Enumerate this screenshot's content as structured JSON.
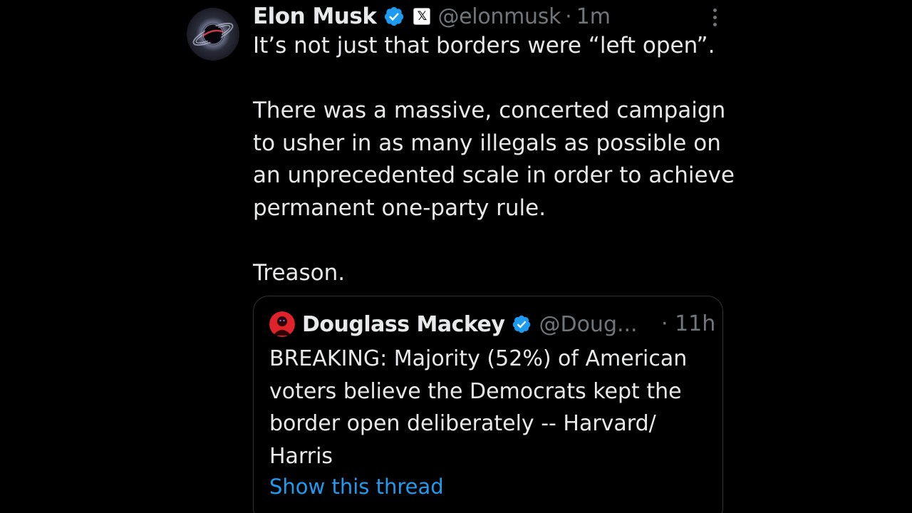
{
  "tweet": {
    "author_name": "Elon Musk",
    "handle": "@elonmusk",
    "separator": "·",
    "time": "1m",
    "avatar_icon": "black-hole-avatar",
    "verified_icon": "verified-badge-icon",
    "affiliate_icon": "x-logo-icon",
    "more_icon": "more-vertical-icon",
    "paragraphs": [
      "It’s not just that borders were “left open”.",
      "There was a massive, concerted campaign to usher in as many illegals as possible on an unprecedented scale in order to achieve permanent one-party rule.",
      "Treason."
    ]
  },
  "quote": {
    "author_name": "Douglass Mackey",
    "handle": "@Doug...",
    "time": "· 11h",
    "text": "BREAKING: Majority (52%) of American voters believe the Democrats kept the border open deliberately -- Harvard/ Harris",
    "link_label": "Show this thread"
  },
  "colors": {
    "background": "#000000",
    "text": "#e7e9ea",
    "muted": "#71767b",
    "accent": "#1d9bf0",
    "border": "#2f3336"
  }
}
